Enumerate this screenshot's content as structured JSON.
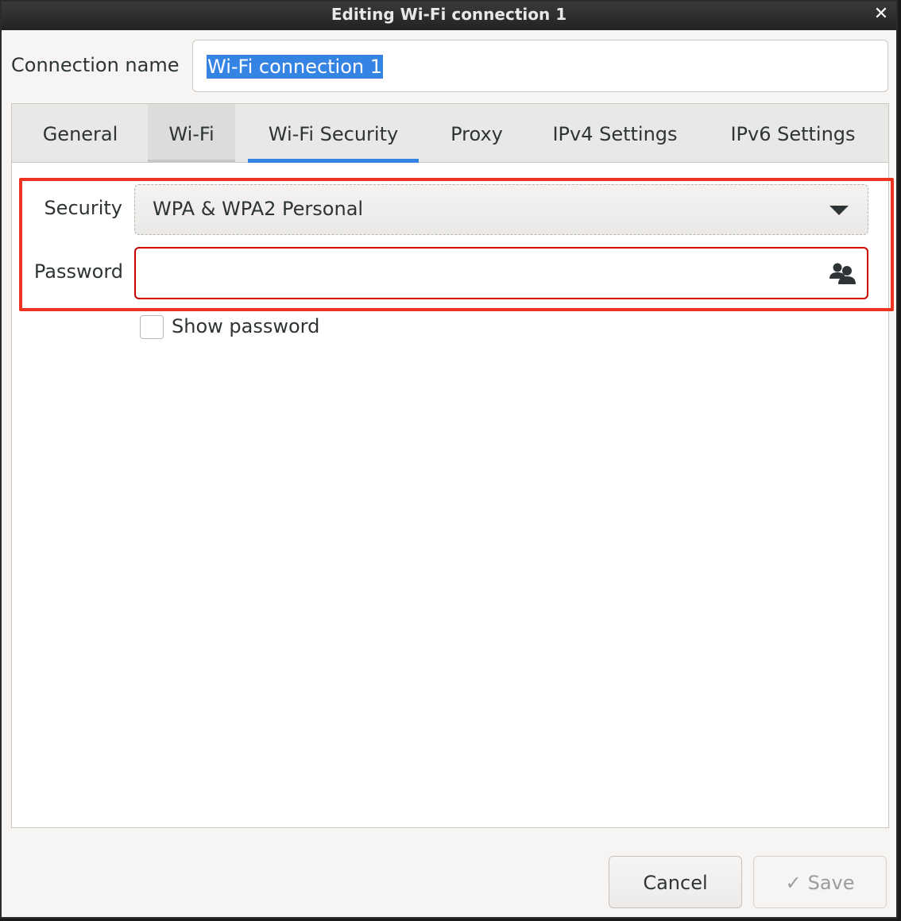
{
  "window": {
    "title": "Editing Wi-Fi connection 1",
    "close_glyph": "✕"
  },
  "connection": {
    "label": "Connection name",
    "value": "Wi-Fi connection 1"
  },
  "tabs": [
    {
      "label": "General"
    },
    {
      "label": "Wi-Fi"
    },
    {
      "label": "Wi-Fi Security"
    },
    {
      "label": "Proxy"
    },
    {
      "label": "IPv4 Settings"
    },
    {
      "label": "IPv6 Settings"
    }
  ],
  "active_tab": "Wi-Fi Security",
  "security": {
    "label": "Security",
    "value": "WPA & WPA2 Personal"
  },
  "password": {
    "label": "Password",
    "value": "",
    "icon": "users-icon"
  },
  "show_password": {
    "label": "Show password",
    "checked": false
  },
  "buttons": {
    "cancel": "Cancel",
    "save": "Save",
    "save_icon": "✓"
  },
  "colors": {
    "accent": "#3584e4",
    "highlight_box": "#ee3322",
    "error_border": "#cc0000"
  }
}
